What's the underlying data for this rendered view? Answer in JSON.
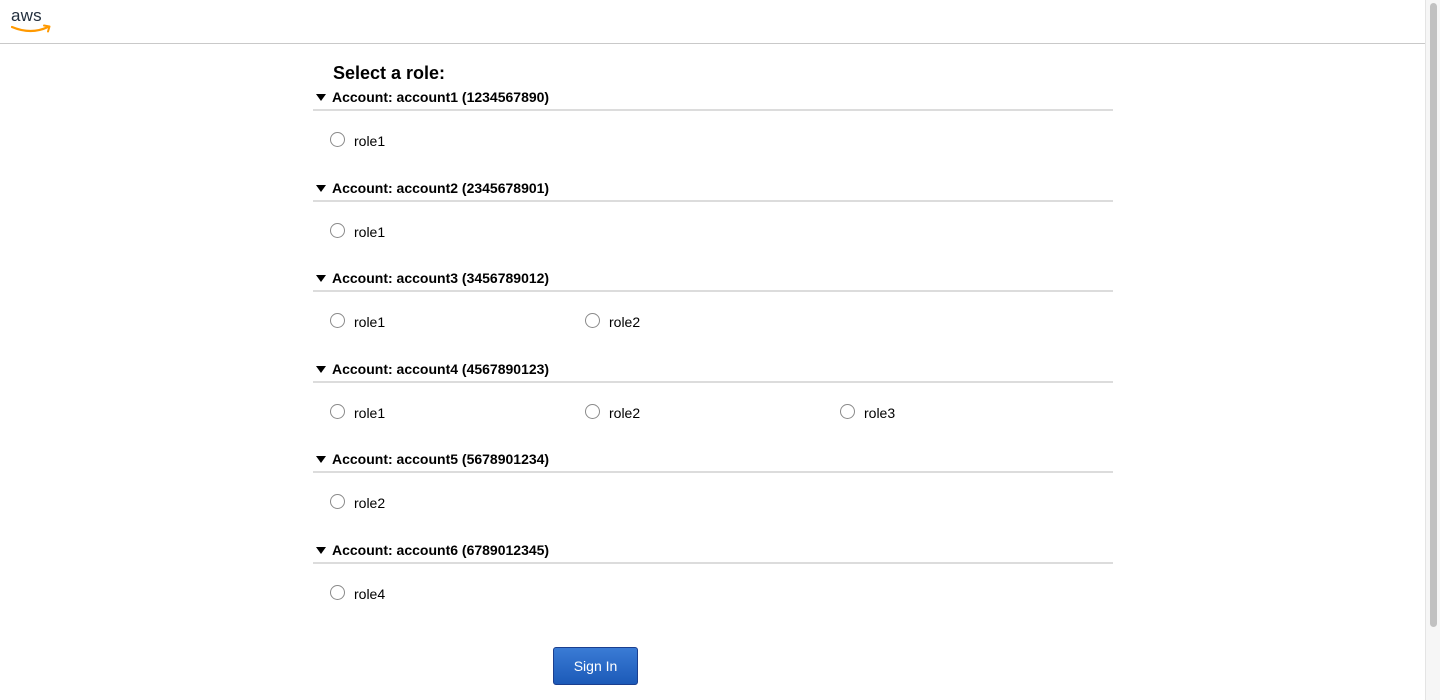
{
  "logo": {
    "text": "aws",
    "smile_color": "#ff9900",
    "text_color": "#232f3e"
  },
  "page_title": "Select a role:",
  "accounts": [
    {
      "label": "Account: account1 (1234567890)",
      "roles": [
        "role1"
      ]
    },
    {
      "label": "Account: account2 (2345678901)",
      "roles": [
        "role1"
      ]
    },
    {
      "label": "Account: account3 (3456789012)",
      "roles": [
        "role1",
        "role2"
      ]
    },
    {
      "label": "Account: account4 (4567890123)",
      "roles": [
        "role1",
        "role2",
        "role3"
      ]
    },
    {
      "label": "Account: account5 (5678901234)",
      "roles": [
        "role2"
      ]
    },
    {
      "label": "Account: account6 (6789012345)",
      "roles": [
        "role4"
      ]
    }
  ],
  "sign_in_label": "Sign In",
  "colors": {
    "button": "#2563c6",
    "divider": "#dcdcdc"
  }
}
